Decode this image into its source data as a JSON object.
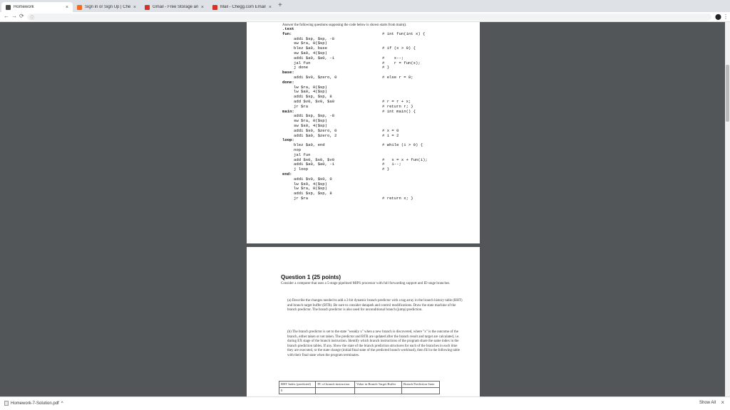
{
  "browser": {
    "tabs": [
      {
        "title": "Homework",
        "active": true,
        "favicon_color": "#4a4a4a"
      },
      {
        "title": "Sign in or Sign Up | Chegg.com",
        "active": false,
        "favicon_color": "#f46b1e"
      },
      {
        "title": "Gmail - Free Storage and Email",
        "active": false,
        "favicon_color": "#d93025"
      },
      {
        "title": "Mail - Chegg.com Email Results",
        "active": false,
        "favicon_color": "#d93025"
      }
    ],
    "close_glyph": "×",
    "new_tab_glyph": "+",
    "back_glyph": "←",
    "forward_glyph": "→",
    "reload_glyph": "⟳",
    "omnibox_glyph": "ⓘ",
    "profile_glyph": "⬤",
    "menu_glyph": "⋮"
  },
  "document": {
    "intro": "Answer the following questions supposing the code below is shown starts from main().",
    "code": [
      {
        "label": ".text",
        "ins": "",
        "cmt": ""
      },
      {
        "label": "fun:",
        "ins": "",
        "cmt": "# int fun(int x) {"
      },
      {
        "label": "",
        "ins": "addi $sp, $sp, -8",
        "cmt": ""
      },
      {
        "label": "",
        "ins": "sw $ra, 0($sp)",
        "cmt": ""
      },
      {
        "label": "",
        "ins": "blez $a0, base",
        "cmt": "# if (x > 0) {"
      },
      {
        "label": "",
        "ins": "sw $a0, 4($sp)",
        "cmt": ""
      },
      {
        "label": "",
        "ins": "addi $a0, $a0, -1",
        "cmt": "#    x--;"
      },
      {
        "label": "",
        "ins": "jal fun",
        "cmt": "#    r = fun(x);"
      },
      {
        "label": "",
        "ins": "j done",
        "cmt": "# }"
      },
      {
        "label": "base:",
        "ins": "",
        "cmt": ""
      },
      {
        "label": "",
        "ins": "addi $v0, $zero, 0",
        "cmt": "# else r = 0;"
      },
      {
        "label": "done:",
        "ins": "",
        "cmt": ""
      },
      {
        "label": "",
        "ins": "lw $ra, 0($sp)",
        "cmt": ""
      },
      {
        "label": "",
        "ins": "lw $a0, 4($sp)",
        "cmt": ""
      },
      {
        "label": "",
        "ins": "addi $sp, $sp, 8",
        "cmt": ""
      },
      {
        "label": "",
        "ins": "add $v0, $v0, $a0",
        "cmt": "# r = r + x;"
      },
      {
        "label": "",
        "ins": "jr $ra",
        "cmt": "# return r; }"
      },
      {
        "label": "main:",
        "ins": "",
        "cmt": "# int main() {"
      },
      {
        "label": "",
        "ins": "addi $sp, $sp, -8",
        "cmt": ""
      },
      {
        "label": "",
        "ins": "sw $ra, 0($sp)",
        "cmt": ""
      },
      {
        "label": "",
        "ins": "sw $s0, 4($sp)",
        "cmt": ""
      },
      {
        "label": "",
        "ins": "addi $s0, $zero, 0",
        "cmt": "# x = 0"
      },
      {
        "label": "",
        "ins": "addi $a0, $zero, 2",
        "cmt": "# i = 2"
      },
      {
        "label": "loop:",
        "ins": "",
        "cmt": ""
      },
      {
        "label": "",
        "ins": "blez $a0, end",
        "cmt": "# while (i > 0) {"
      },
      {
        "label": "",
        "ins": "nop",
        "cmt": ""
      },
      {
        "label": "",
        "ins": "jal fun",
        "cmt": ""
      },
      {
        "label": "",
        "ins": "add $s0, $s0, $v0",
        "cmt": "#   x = x + fun(i);"
      },
      {
        "label": "",
        "ins": "addi $a0, $a0, -1",
        "cmt": "#   i--;"
      },
      {
        "label": "",
        "ins": "j loop",
        "cmt": "# }"
      },
      {
        "label": "end:",
        "ins": "",
        "cmt": ""
      },
      {
        "label": "",
        "ins": "addi $v0, $s0, 0",
        "cmt": ""
      },
      {
        "label": "",
        "ins": "lw $s0, 4($sp)",
        "cmt": ""
      },
      {
        "label": "",
        "ins": "lw $ra, 0($sp)",
        "cmt": ""
      },
      {
        "label": "",
        "ins": "addi $sp, $sp, 8",
        "cmt": ""
      },
      {
        "label": "",
        "ins": "jr $ra",
        "cmt": "# return x; }"
      }
    ],
    "question": {
      "title": "Question 1 (25 points)",
      "intro": "Consider a computer that uses a 5-stage pipelined MIPS processor with full forwarding support and ID stage branches.",
      "part_a": "(a) Describe the changes needed to add a 2-bit dynamic branch predictor with a tag array in the branch history table (BHT) and branch target buffer (BTB). Be sure to consider datapath and control modifications. Draw the state machine of the branch predictor. The branch predictor is also used for unconditional branch (jump) prediction.",
      "part_b": "(b) The branch predictor is set to the state \"weakly x\" when a new branch is discovered, where \"x\" is the outcome of the branch, either taken or not taken. The predictor and BTB are updated after the branch result and target are calculated, i.e. during EX stage of the branch instruction. Identify which branch instructions of the program share the same index in the branch prediction tables. If any. Show the state of the branch prediction structures for each of the branches in each time they are executed, or the state change (initial/final state of the predicted branch workload), then fill in the following table with their final state when the program terminates.",
      "table": {
        "headers": [
          "BHT Index (predicted)",
          "PC of branch instruction",
          "Value in Branch Target Buffer",
          "Branch Prediction State"
        ],
        "rows": [
          [
            "0",
            "",
            "",
            ""
          ]
        ]
      }
    }
  },
  "downloads": {
    "file_name": "Homework-7-Solution.pdf",
    "caret_glyph": "^",
    "show_all": "Show All",
    "close_glyph": "×"
  }
}
